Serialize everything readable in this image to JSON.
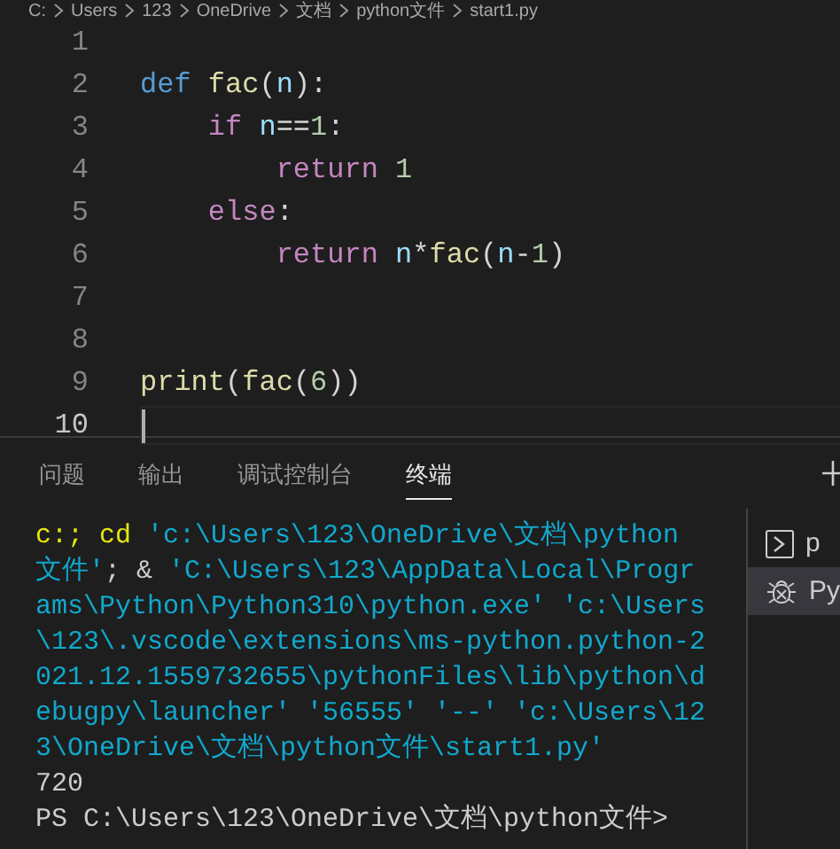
{
  "breadcrumb": [
    "C:",
    "Users",
    "123",
    "OneDrive",
    "文档",
    "python文件",
    "start1.py"
  ],
  "editor": {
    "lines": [
      {
        "number": "1",
        "active": false
      },
      {
        "number": "2",
        "active": false,
        "tokens": [
          {
            "kind": "keyword",
            "text": "def"
          },
          {
            "kind": "func",
            "text": " fac"
          },
          {
            "kind": "plain",
            "text": "("
          },
          {
            "kind": "var",
            "text": "n"
          },
          {
            "kind": "plain",
            "text": "):"
          }
        ]
      },
      {
        "number": "3",
        "active": false,
        "tokens": [
          {
            "kind": "control",
            "text": "    if"
          },
          {
            "kind": "var",
            "text": " n"
          },
          {
            "kind": "plain",
            "text": "=="
          },
          {
            "kind": "num",
            "text": "1"
          },
          {
            "kind": "plain",
            "text": ":"
          }
        ]
      },
      {
        "number": "4",
        "active": false,
        "tokens": [
          {
            "kind": "control",
            "text": "        return"
          },
          {
            "kind": "num",
            "text": " 1"
          }
        ]
      },
      {
        "number": "5",
        "active": false,
        "tokens": [
          {
            "kind": "control",
            "text": "    else"
          },
          {
            "kind": "plain",
            "text": ":"
          }
        ]
      },
      {
        "number": "6",
        "active": false,
        "tokens": [
          {
            "kind": "control",
            "text": "        return"
          },
          {
            "kind": "var",
            "text": " n"
          },
          {
            "kind": "plain",
            "text": "*"
          },
          {
            "kind": "func",
            "text": "fac"
          },
          {
            "kind": "plain",
            "text": "("
          },
          {
            "kind": "var",
            "text": "n"
          },
          {
            "kind": "plain",
            "text": "-"
          },
          {
            "kind": "num",
            "text": "1"
          },
          {
            "kind": "plain",
            "text": ")"
          }
        ]
      },
      {
        "number": "7",
        "active": false
      },
      {
        "number": "8",
        "active": false
      },
      {
        "number": "9",
        "active": false,
        "tokens": [
          {
            "kind": "func",
            "text": "print"
          },
          {
            "kind": "plain",
            "text": "("
          },
          {
            "kind": "func",
            "text": "fac"
          },
          {
            "kind": "plain",
            "text": "("
          },
          {
            "kind": "num",
            "text": "6"
          },
          {
            "kind": "plain",
            "text": "))"
          }
        ]
      },
      {
        "number": "10",
        "active": true
      }
    ]
  },
  "panel_tabs": [
    {
      "label": "问题",
      "selected": false
    },
    {
      "label": "输出",
      "selected": false
    },
    {
      "label": "调试控制台",
      "selected": false
    },
    {
      "label": "终端",
      "selected": true
    }
  ],
  "terminal": {
    "lines": [
      [
        {
          "kind": "command",
          "text": "c:; cd "
        },
        {
          "kind": "string",
          "text": "'c:\\Users\\123\\OneDrive\\文档\\python"
        }
      ],
      [
        {
          "kind": "string",
          "text": "文件'"
        },
        {
          "kind": "plain",
          "text": "; & "
        },
        {
          "kind": "string",
          "text": "'C:\\Users\\123\\AppData\\Local\\Progr"
        }
      ],
      [
        {
          "kind": "string",
          "text": "ams\\Python\\Python310\\python.exe' 'c:\\Users"
        }
      ],
      [
        {
          "kind": "string",
          "text": "\\123\\.vscode\\extensions\\ms-python.python-2"
        }
      ],
      [
        {
          "kind": "string",
          "text": "021.12.1559732655\\pythonFiles\\lib\\python\\d"
        }
      ],
      [
        {
          "kind": "string",
          "text": "ebugpy\\launcher' '56555' '--' 'c:\\Users\\12"
        }
      ],
      [
        {
          "kind": "string",
          "text": "3\\OneDrive\\文档\\python文件\\start1.py'"
        }
      ],
      [
        {
          "kind": "plain",
          "text": "720"
        }
      ],
      [
        {
          "kind": "plain",
          "text": "PS C:\\Users\\123\\OneDrive\\文档\\python文件>"
        }
      ]
    ]
  },
  "terminal_list": [
    {
      "kind": "shell",
      "label": "p",
      "selected": false
    },
    {
      "kind": "debug",
      "label": "Py",
      "selected": true
    }
  ]
}
